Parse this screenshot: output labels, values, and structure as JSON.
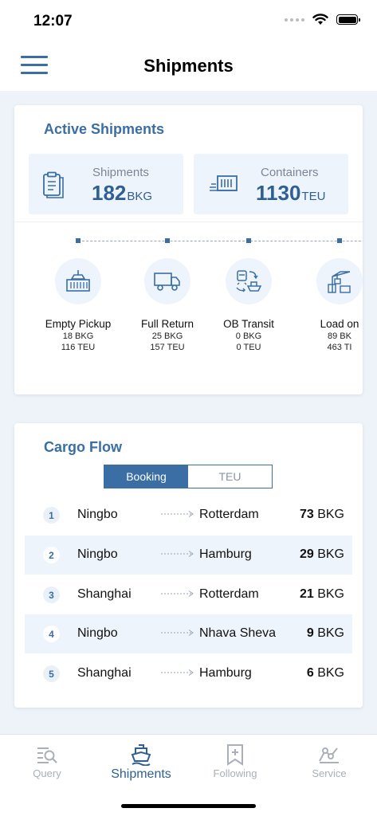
{
  "status_bar": {
    "time": "12:07"
  },
  "nav": {
    "title": "Shipments"
  },
  "active_shipments": {
    "title": "Active Shipments",
    "shipments": {
      "label": "Shipments",
      "value": "182",
      "unit": "BKG"
    },
    "containers": {
      "label": "Containers",
      "value": "1130",
      "unit": "TEU"
    },
    "stages": [
      {
        "name": "Empty Pickup",
        "bkg": "18 BKG",
        "teu": "116 TEU"
      },
      {
        "name": "Full Return",
        "bkg": "25 BKG",
        "teu": "157 TEU"
      },
      {
        "name": "OB Transit",
        "bkg": "0 BKG",
        "teu": "0 TEU"
      },
      {
        "name": "Load on",
        "bkg": "89 BK",
        "teu": "463 TI"
      }
    ]
  },
  "cargo_flow": {
    "title": "Cargo Flow",
    "toggle": {
      "booking": "Booking",
      "teu": "TEU"
    },
    "rows": [
      {
        "rank": "1",
        "origin": "Ningbo",
        "destination": "Rotterdam",
        "count": "73",
        "unit": "BKG"
      },
      {
        "rank": "2",
        "origin": "Ningbo",
        "destination": "Hamburg",
        "count": "29",
        "unit": "BKG"
      },
      {
        "rank": "3",
        "origin": "Shanghai",
        "destination": "Rotterdam",
        "count": "21",
        "unit": "BKG"
      },
      {
        "rank": "4",
        "origin": "Ningbo",
        "destination": "Nhava Sheva",
        "count": "9",
        "unit": "BKG"
      },
      {
        "rank": "5",
        "origin": "Shanghai",
        "destination": "Hamburg",
        "count": "6",
        "unit": "BKG"
      }
    ]
  },
  "tab_bar": {
    "query": "Query",
    "shipments": "Shipments",
    "following": "Following",
    "service": "Service"
  },
  "colors": {
    "accent": "#3a6ea5",
    "tint": "#eef4fb",
    "inactive": "#a9b0ba"
  }
}
